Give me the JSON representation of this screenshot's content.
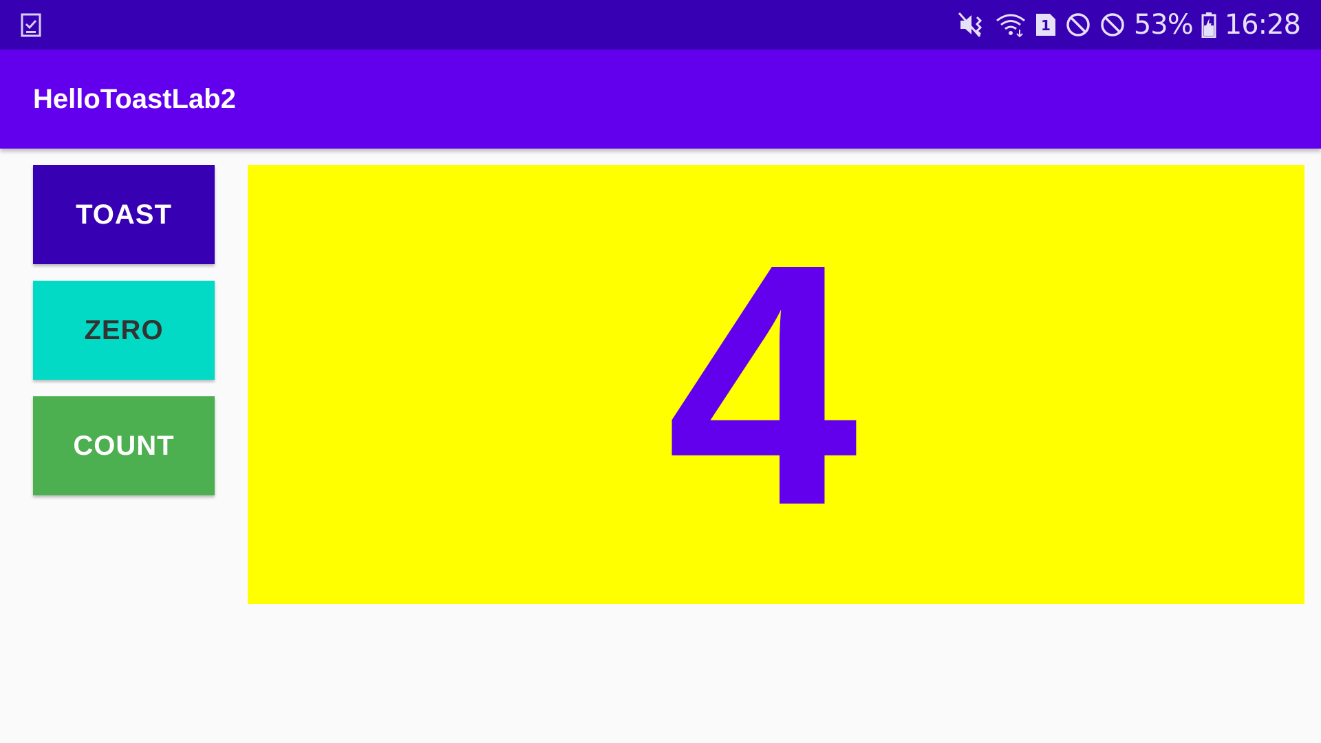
{
  "status_bar": {
    "left_icon": "clipboard-check-icon",
    "icons": [
      "vibrate-mute-icon",
      "wifi-icon",
      "sim-1-icon",
      "do-not-disturb-icon",
      "block-icon"
    ],
    "battery": "53%",
    "battery_icon": "battery-charging-icon",
    "time": "16:28",
    "background": "#3700b3"
  },
  "app_bar": {
    "title": "HelloToastLab2",
    "background": "#6200ee"
  },
  "buttons": {
    "toast": {
      "label": "TOAST",
      "background": "#3700b3",
      "color": "#ffffff"
    },
    "zero": {
      "label": "ZERO",
      "background": "#03dac5",
      "color": "#333333"
    },
    "count": {
      "label": "COUNT",
      "background": "#4caf50",
      "color": "#ffffff"
    }
  },
  "counter": {
    "value": "4",
    "background": "#ffff00",
    "color": "#6200ee"
  }
}
